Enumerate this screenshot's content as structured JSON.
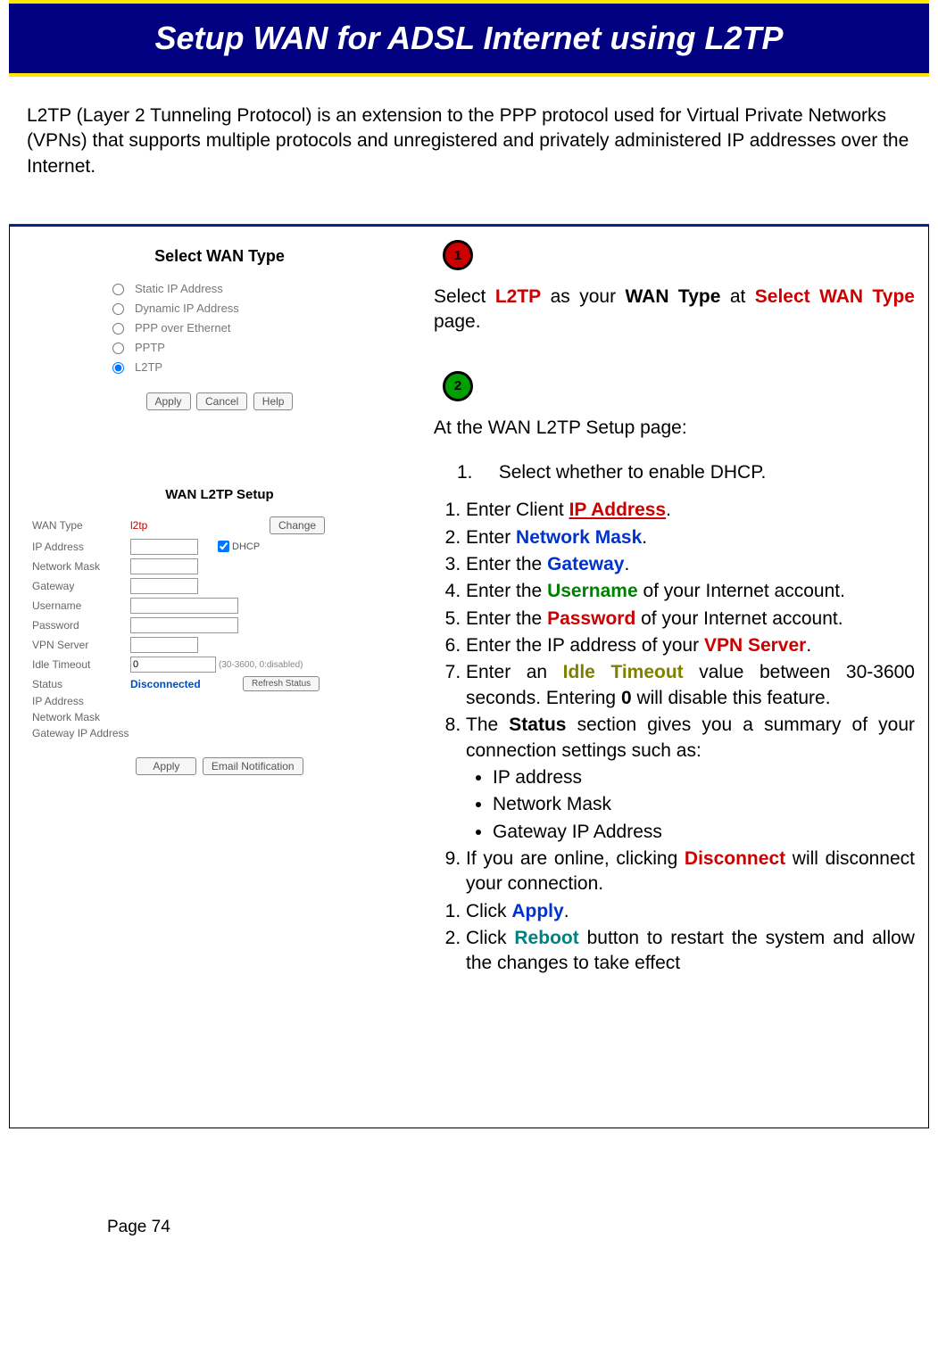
{
  "header_title": "Setup WAN for ADSL Internet using L2TP",
  "intro": "L2TP (Layer 2 Tunneling Protocol) is an extension to the PPP protocol used for Virtual Private Networks (VPNs) that supports multiple protocols and unregistered and privately administered IP addresses over the Internet.",
  "panel1": {
    "title": "Select WAN Type",
    "options": [
      "Static IP Address",
      "Dynamic IP Address",
      "PPP over Ethernet",
      "PPTP",
      "L2TP"
    ],
    "buttons": {
      "apply": "Apply",
      "cancel": "Cancel",
      "help": "Help"
    }
  },
  "panel2": {
    "title": "WAN L2TP Setup",
    "rows": {
      "wan_type_label": "WAN Type",
      "wan_type_value": "l2tp",
      "change_btn": "Change",
      "ip_address": "IP Address",
      "dhcp": "DHCP",
      "network_mask": "Network Mask",
      "gateway": "Gateway",
      "username": "Username",
      "password": "Password",
      "vpn_server": "VPN Server",
      "idle_timeout": "Idle Timeout",
      "idle_value": "0",
      "idle_hint": "(30-3600, 0:disabled)",
      "status_label": "Status",
      "status_value": "Disconnected",
      "refresh_btn": "Refresh Status",
      "ip_address2": "IP Address",
      "network_mask2": "Network Mask",
      "gateway_ip": "Gateway IP Address",
      "apply_btn": "Apply",
      "email_btn": "Email Notification"
    }
  },
  "steps": {
    "badge1": "1",
    "badge2": "2",
    "s1": {
      "pre": "Select ",
      "l2tp": "L2TP",
      "mid1": " as your ",
      "wan_type": "WAN Type",
      "mid2": " at ",
      "select_wan": "Select WAN Type",
      "post": " page."
    },
    "s2_intro": "At the WAN L2TP Setup page:",
    "s2_first_num": "1.",
    "s2_first": "Select whether to enable DHCP.",
    "li1_pre": "Enter Client ",
    "li1_term": "IP Address",
    "li1_post": ".",
    "li2_pre": "Enter ",
    "li2_term": "Network Mask",
    "li2_post": ".",
    "li3_pre": "Enter the ",
    "li3_term": "Gateway",
    "li3_post": ".",
    "li4_pre": "Enter the ",
    "li4_term": "Username",
    "li4_post": " of your Internet account.",
    "li5_pre": "Enter the ",
    "li5_term": "Password",
    "li5_post": " of your Internet account.",
    "li6_pre": "Enter the IP address of your ",
    "li6_term": "VPN Server",
    "li6_post": ".",
    "li7_pre": "Enter an ",
    "li7_term": "Idle Timeout",
    "li7_mid": " value between 30-3600 seconds. Entering ",
    "li7_zero": "0",
    "li7_post": " will disable this feature.",
    "li8_pre": "The ",
    "li8_term": "Status",
    "li8_post": " section gives you a summary of your connection settings such as:",
    "li8_b1": "IP address",
    "li8_b2": "Network Mask",
    "li8_b3": "Gateway IP Address",
    "li9_pre": "If you are online, clicking ",
    "li9_term": "Disconnect",
    "li9_post": " will disconnect your connection.",
    "li10_pre": "Click ",
    "li10_term": "Apply",
    "li10_post": ".",
    "li11_pre": "Click ",
    "li11_term": "Reboot",
    "li11_post": " button to restart the system and allow the changes to take effect"
  },
  "page_number": "Page 74"
}
